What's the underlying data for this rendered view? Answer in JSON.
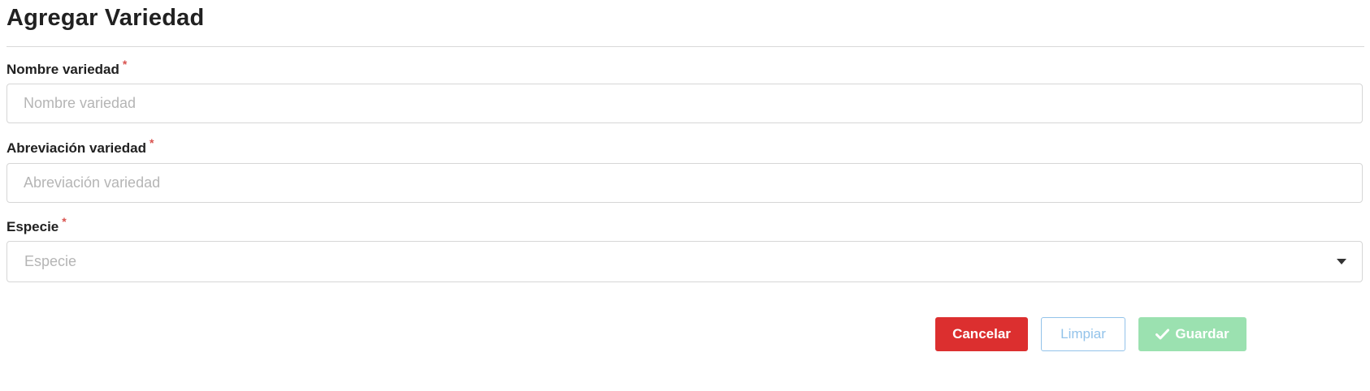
{
  "page": {
    "title": "Agregar Variedad"
  },
  "form": {
    "required_marker": "*",
    "nombre": {
      "label": "Nombre variedad",
      "placeholder": "Nombre variedad",
      "value": ""
    },
    "abreviacion": {
      "label": "Abreviación variedad",
      "placeholder": "Abreviación variedad",
      "value": ""
    },
    "especie": {
      "label": "Especie",
      "placeholder": "Especie",
      "selected": ""
    }
  },
  "actions": {
    "cancel_label": "Cancelar",
    "clear_label": "Limpiar",
    "save_label": "Guardar",
    "save_icon": "check-icon"
  },
  "colors": {
    "cancel": "#dc2f2f",
    "clear_border": "#93c3ea",
    "save": "#9be1b0",
    "required": "#d9534f"
  }
}
